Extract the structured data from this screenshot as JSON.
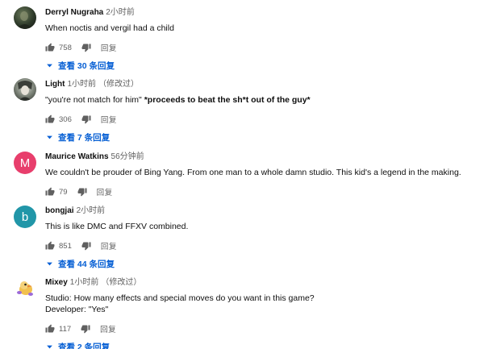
{
  "colors": {
    "link": "#065fd4",
    "meta": "#606060",
    "avatar_m": "#e83e6c",
    "avatar_b": "#2196a8"
  },
  "comments": [
    {
      "author": "Derryl Nugraha",
      "time": "2小时前",
      "edited": "",
      "text": "When noctis and vergil had a child",
      "likes": "758",
      "reply_label": "回复",
      "view_replies": "查看 30 条回复",
      "avatar_icon": "dark-photo-avatar"
    },
    {
      "author": "Light",
      "time": "1小时前",
      "edited": "（修改过）",
      "text_plain": "\"you're not match for him\" ",
      "text_bold": "*proceeds to beat the sh*t out of the guy*",
      "likes": "306",
      "reply_label": "回复",
      "view_replies": "查看 7 条回复",
      "avatar_icon": "anime-character-avatar"
    },
    {
      "author": "Maurice Watkins",
      "time": "56分钟前",
      "edited": "",
      "text": "We couldn't be prouder of Bing Yang. From one man to a whole damn studio. This kid's a legend in the making.",
      "likes": "79",
      "reply_label": "回复",
      "avatar_letter": "M"
    },
    {
      "author": "bongjai",
      "time": "2小时前",
      "edited": "",
      "text": "This is like DMC and FFXV combined.",
      "likes": "851",
      "reply_label": "回复",
      "view_replies": "查看 44 条回复",
      "avatar_letter": "b"
    },
    {
      "author": "Mixey",
      "time": "1小时前",
      "edited": "（修改过）",
      "text": "Studio: How many effects and special moves do you want in this game?\nDeveloper: \"Yes\"",
      "likes": "117",
      "reply_label": "回复",
      "view_replies": "查看 2 条回复",
      "avatar_icon": "cartoon-duck-avatar"
    }
  ]
}
